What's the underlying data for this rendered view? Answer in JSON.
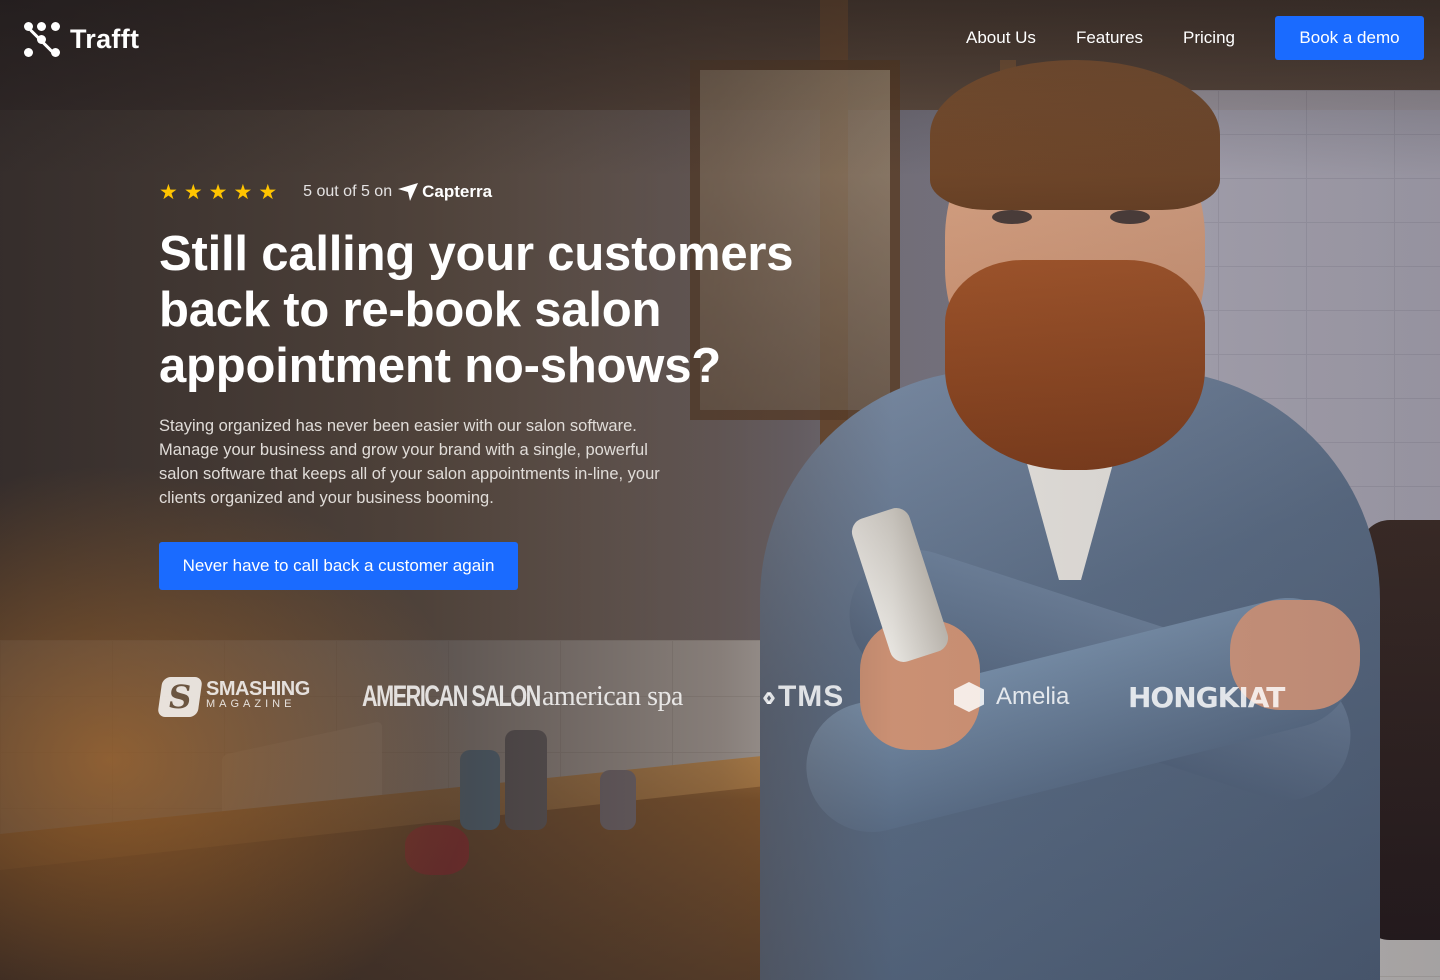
{
  "header": {
    "logo_text": "Trafft",
    "nav": [
      {
        "label": "About Us"
      },
      {
        "label": "Features"
      },
      {
        "label": "Pricing"
      }
    ],
    "demo_button": "Book a demo"
  },
  "hero": {
    "rating": {
      "stars": 5,
      "star_glyph": "★",
      "text": "5 out of 5 on",
      "source": "Capterra"
    },
    "headline": "Still calling your customers back to re-book salon appointment no-shows?",
    "description": "Staying organized has never been easier with our salon software. Manage your business and grow your brand with a single, powerful salon software that keeps all of your salon appointments in-line, your clients organized and your business booming.",
    "cta_button": "Never have to call back a customer again"
  },
  "press_logos": {
    "smashing": {
      "line1": "SMASHING",
      "line2": "MAGAZINE"
    },
    "american_salon": "AMERICAN SALON",
    "american_spa": "american spa",
    "tms": "TMS",
    "amelia": "Amelia",
    "hongkiat": "HONGKIAT"
  },
  "colors": {
    "primary": "#1a6bff",
    "star": "#ffc400",
    "text": "#ffffff"
  }
}
